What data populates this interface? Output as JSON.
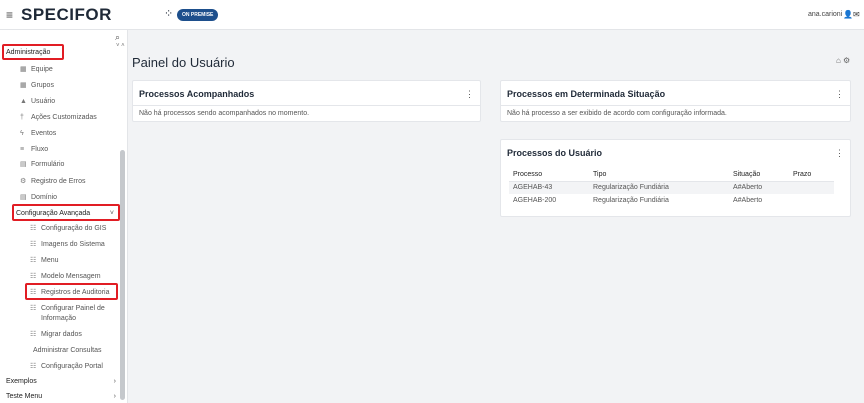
{
  "topbar": {
    "menu_icon": "hamburger-icon",
    "brand": "SPECIFOR",
    "brand_dots": "⁘",
    "badge": "ON PREMISE",
    "user_name": "ana.carioni",
    "user_icons": "👤✉"
  },
  "sidebar": {
    "search_icon": "⌕",
    "collapse_arrows": "˅ ˄",
    "admin_label": "Administração",
    "items": [
      {
        "label": "Equipe",
        "icon": "▦"
      },
      {
        "label": "Grupos",
        "icon": "▦"
      },
      {
        "label": "Usuário",
        "icon": "▲"
      },
      {
        "label": "Ações Customizadas",
        "icon": "†"
      },
      {
        "label": "Eventos",
        "icon": "ϟ"
      },
      {
        "label": "Fluxo",
        "icon": "≡"
      },
      {
        "label": "Formulário",
        "icon": "▤"
      },
      {
        "label": "Registro de Erros",
        "icon": "⚙"
      },
      {
        "label": "Domínio",
        "icon": "▤"
      }
    ],
    "config_label": "Configuração Avançada",
    "config_chevron": "˅",
    "config_items": [
      {
        "label": "Configuração do GIS",
        "icon": "☷"
      },
      {
        "label": "Imagens do Sistema",
        "icon": "☷"
      },
      {
        "label": "Menu",
        "icon": "☷"
      },
      {
        "label": "Modelo Mensagem",
        "icon": "☷"
      },
      {
        "label": "Registros de Auditoria",
        "icon": "☷"
      },
      {
        "label": "Configurar Painel de",
        "label2": "Informação",
        "icon": "☷"
      },
      {
        "label": "Migrar dados",
        "icon": "☷"
      },
      {
        "label": "Administrar Consultas",
        "icon": ""
      },
      {
        "label": "Configuração Portal",
        "icon": "☷"
      }
    ],
    "bottom_items": [
      {
        "label": "Exemplos",
        "chevron": "›"
      },
      {
        "label": "Teste Menu",
        "chevron": "›"
      }
    ]
  },
  "main": {
    "title": "Painel do Usuário",
    "title_icons": "⌂ ⚙",
    "panels": {
      "acompanhados": {
        "title": "Processos Acompanhados",
        "menu": "⋮",
        "message": "Não há processos sendo acompanhados no momento."
      },
      "situacao": {
        "title": "Processos em Determinada Situação",
        "menu": "⋮",
        "message": "Não há processo a ser exibido de acordo com configuração informada."
      },
      "usuario": {
        "title": "Processos do Usuário",
        "menu": "⋮",
        "columns": [
          "Processo",
          "Tipo",
          "Situação",
          "Prazo"
        ],
        "rows": [
          [
            "AGEHAB-43",
            "Regularização Fundiária",
            "A#Aberto",
            ""
          ],
          [
            "AGEHAB-200",
            "Regularização Fundiária",
            "A#Aberto",
            ""
          ]
        ]
      }
    }
  },
  "colors": {
    "highlight": "#e11d24",
    "badge": "#1d4f8c",
    "background": "#f2f3f5"
  }
}
